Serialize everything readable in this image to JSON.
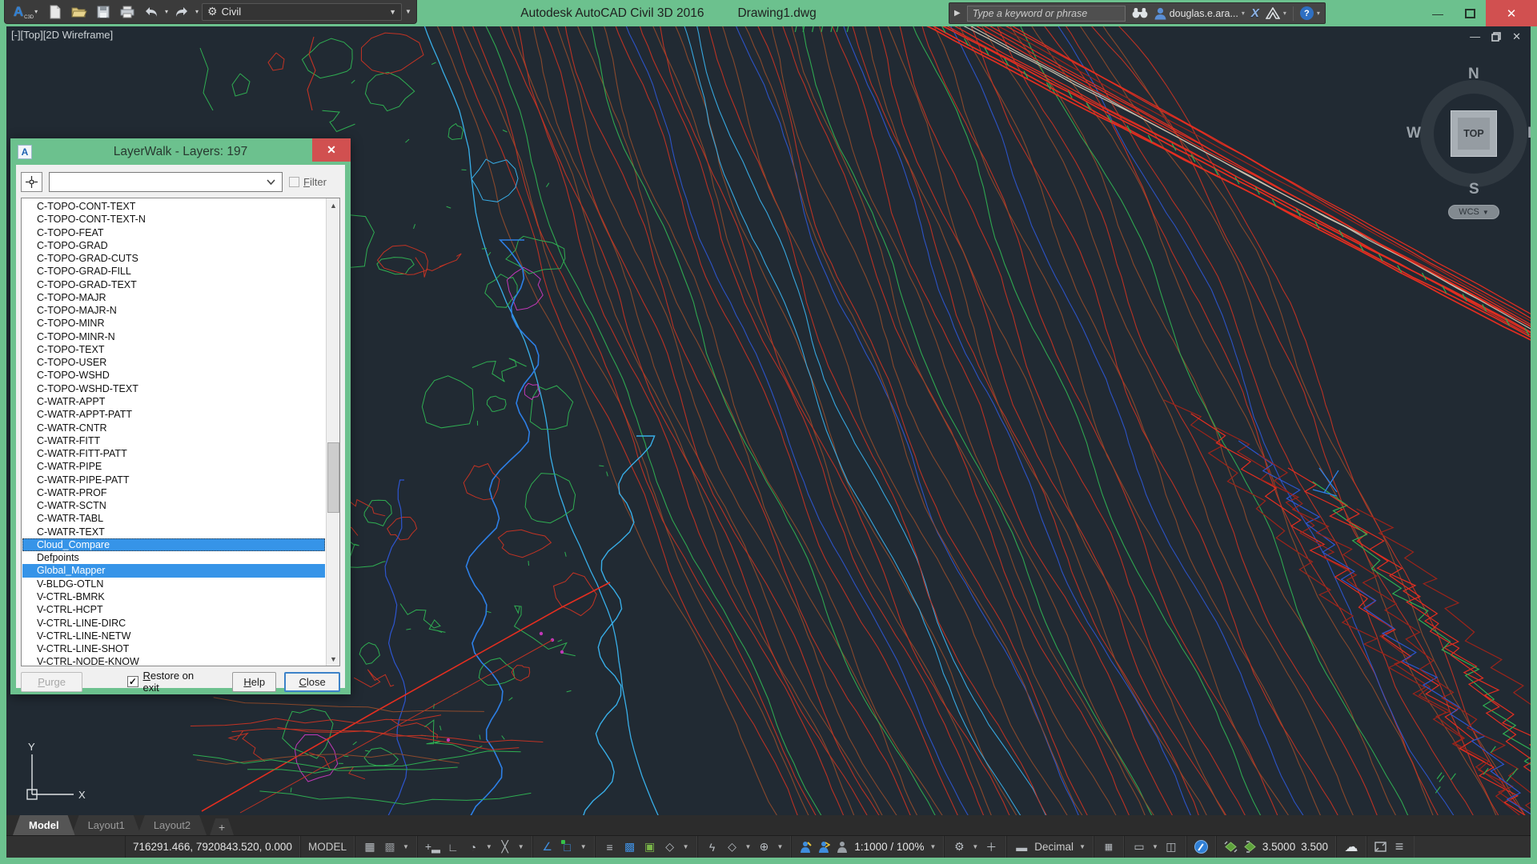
{
  "titlebar": {
    "workspace": "Civil",
    "app_title": "Autodesk AutoCAD Civil 3D 2016",
    "doc_title": "Drawing1.dwg",
    "search_placeholder": "Type a keyword or phrase",
    "user": "douglas.e.ara...",
    "logo_sub": "C3D",
    "exchange_x": "X",
    "help_q": "?"
  },
  "viewport": {
    "label": "[-][Top][2D Wireframe]",
    "viewcube": {
      "north": "N",
      "south": "S",
      "east": "E",
      "west": "W",
      "face": "TOP",
      "wcs": "WCS"
    },
    "ucs": {
      "x_label": "X",
      "y_label": "Y"
    }
  },
  "layerwalk": {
    "title": "LayerWalk - Layers: 197",
    "filter_label": "Filter",
    "purge_label": "Purge",
    "restore_label": "Restore on exit",
    "restore_checked": "✓",
    "help_label": "Help",
    "close_label": "Close",
    "layers": [
      {
        "name": "C-TOPO-CONT-TEXT"
      },
      {
        "name": "C-TOPO-CONT-TEXT-N"
      },
      {
        "name": "C-TOPO-FEAT"
      },
      {
        "name": "C-TOPO-GRAD"
      },
      {
        "name": "C-TOPO-GRAD-CUTS"
      },
      {
        "name": "C-TOPO-GRAD-FILL"
      },
      {
        "name": "C-TOPO-GRAD-TEXT"
      },
      {
        "name": "C-TOPO-MAJR"
      },
      {
        "name": "C-TOPO-MAJR-N"
      },
      {
        "name": "C-TOPO-MINR"
      },
      {
        "name": "C-TOPO-MINR-N"
      },
      {
        "name": "C-TOPO-TEXT"
      },
      {
        "name": "C-TOPO-USER"
      },
      {
        "name": "C-TOPO-WSHD"
      },
      {
        "name": "C-TOPO-WSHD-TEXT"
      },
      {
        "name": "C-WATR-APPT"
      },
      {
        "name": "C-WATR-APPT-PATT"
      },
      {
        "name": "C-WATR-CNTR"
      },
      {
        "name": "C-WATR-FITT"
      },
      {
        "name": "C-WATR-FITT-PATT"
      },
      {
        "name": "C-WATR-PIPE"
      },
      {
        "name": "C-WATR-PIPE-PATT"
      },
      {
        "name": "C-WATR-PROF"
      },
      {
        "name": "C-WATR-SCTN"
      },
      {
        "name": "C-WATR-TABL"
      },
      {
        "name": "C-WATR-TEXT"
      },
      {
        "name": "Cloud_Compare",
        "selected": true,
        "focus": true
      },
      {
        "name": "Defpoints"
      },
      {
        "name": "Global_Mapper",
        "selected": true
      },
      {
        "name": "V-BLDG-OTLN"
      },
      {
        "name": "V-CTRL-BMRK"
      },
      {
        "name": "V-CTRL-HCPT"
      },
      {
        "name": "V-CTRL-LINE-DIRC"
      },
      {
        "name": "V-CTRL-LINE-NETW"
      },
      {
        "name": "V-CTRL-LINE-SHOT"
      },
      {
        "name": "V-CTRL-NODE-KNOW"
      }
    ]
  },
  "tabs": {
    "items": [
      {
        "label": "Model",
        "active": true
      },
      {
        "label": "Layout1",
        "active": false
      },
      {
        "label": "Layout2",
        "active": false
      }
    ],
    "add_label": "+"
  },
  "statusbar": {
    "coords": "716291.466, 7920843.520, 0.000",
    "model_label": "MODEL",
    "scale": "1:1000 / 100%",
    "units": "Decimal",
    "annot_scale_current": "3.5000",
    "annot_scale_new": "3.500"
  },
  "canvas": {
    "bg": "#212a33",
    "palette": {
      "red": "#c23324",
      "brown": "#8e4a2c",
      "green": "#2fae52",
      "blue": "#2d55cf",
      "cyan": "#38aee8",
      "band_red": "#e42e20",
      "dark_red": "#9c241a",
      "magenta": "#c238b8",
      "pale": "#c9bcab",
      "stream": "#2d7fe6"
    }
  }
}
